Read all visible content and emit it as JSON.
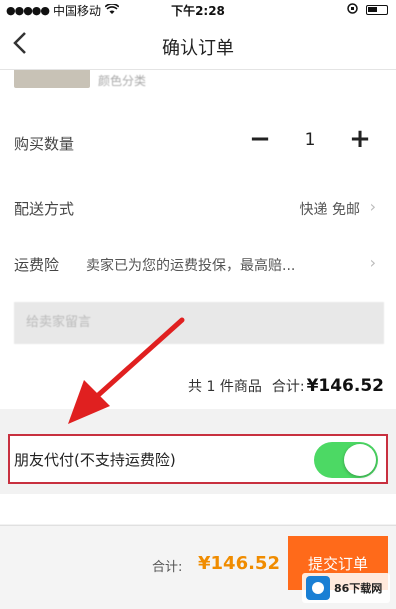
{
  "status_bar": {
    "signal": "●●●●●",
    "carrier": "中国移动",
    "wifi_icon": "wifi-icon",
    "time": "下午2:28"
  },
  "nav": {
    "back_icon": "chevron-left-icon",
    "title": "确认订单"
  },
  "product": {
    "peek_text": "颜色分类"
  },
  "quantity": {
    "label": "购买数量",
    "minus": "−",
    "value": "1",
    "plus": "+"
  },
  "delivery": {
    "label": "配送方式",
    "value": "快递 免邮",
    "chevron": "›"
  },
  "insurance": {
    "label": "运费险",
    "value": "卖家已为您的运费投保，最高赔...",
    "chevron": "›"
  },
  "message": {
    "placeholder": "给卖家留言"
  },
  "summary": {
    "count_text": "共 1 件商品",
    "total_label": "合计:",
    "total_value": "¥146.52"
  },
  "friend_pay": {
    "label": "朋友代付(不支持运费险)",
    "enabled": true,
    "color": "#4cd964"
  },
  "bottom_bar": {
    "total_label": "合计:",
    "total_value": "¥146.52",
    "submit_label": "提交订单",
    "submit_color": "#ff6a1a"
  },
  "watermark": {
    "text": "86下载网"
  },
  "colors": {
    "highlight_border": "#c8303f",
    "price_orange": "#f08c00",
    "arrow_red": "#e02020"
  }
}
